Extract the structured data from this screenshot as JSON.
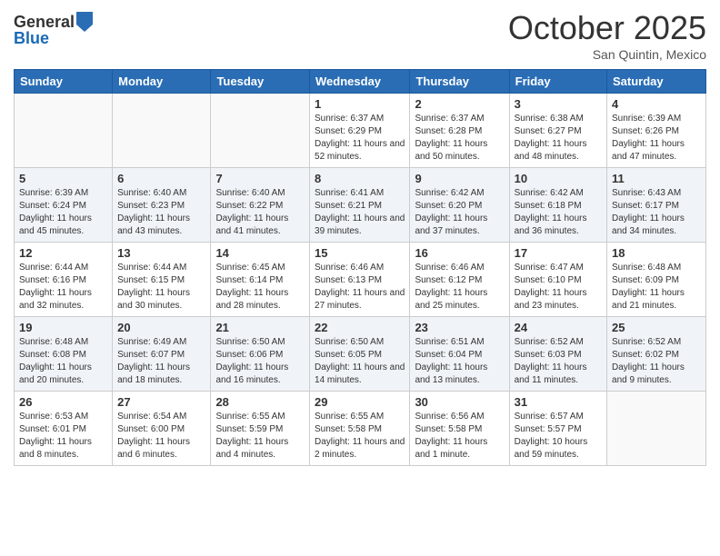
{
  "header": {
    "logo_general": "General",
    "logo_blue": "Blue",
    "month": "October 2025",
    "location": "San Quintin, Mexico"
  },
  "days_of_week": [
    "Sunday",
    "Monday",
    "Tuesday",
    "Wednesday",
    "Thursday",
    "Friday",
    "Saturday"
  ],
  "weeks": [
    [
      {
        "day": "",
        "info": ""
      },
      {
        "day": "",
        "info": ""
      },
      {
        "day": "",
        "info": ""
      },
      {
        "day": "1",
        "info": "Sunrise: 6:37 AM\nSunset: 6:29 PM\nDaylight: 11 hours and 52 minutes."
      },
      {
        "day": "2",
        "info": "Sunrise: 6:37 AM\nSunset: 6:28 PM\nDaylight: 11 hours and 50 minutes."
      },
      {
        "day": "3",
        "info": "Sunrise: 6:38 AM\nSunset: 6:27 PM\nDaylight: 11 hours and 48 minutes."
      },
      {
        "day": "4",
        "info": "Sunrise: 6:39 AM\nSunset: 6:26 PM\nDaylight: 11 hours and 47 minutes."
      }
    ],
    [
      {
        "day": "5",
        "info": "Sunrise: 6:39 AM\nSunset: 6:24 PM\nDaylight: 11 hours and 45 minutes."
      },
      {
        "day": "6",
        "info": "Sunrise: 6:40 AM\nSunset: 6:23 PM\nDaylight: 11 hours and 43 minutes."
      },
      {
        "day": "7",
        "info": "Sunrise: 6:40 AM\nSunset: 6:22 PM\nDaylight: 11 hours and 41 minutes."
      },
      {
        "day": "8",
        "info": "Sunrise: 6:41 AM\nSunset: 6:21 PM\nDaylight: 11 hours and 39 minutes."
      },
      {
        "day": "9",
        "info": "Sunrise: 6:42 AM\nSunset: 6:20 PM\nDaylight: 11 hours and 37 minutes."
      },
      {
        "day": "10",
        "info": "Sunrise: 6:42 AM\nSunset: 6:18 PM\nDaylight: 11 hours and 36 minutes."
      },
      {
        "day": "11",
        "info": "Sunrise: 6:43 AM\nSunset: 6:17 PM\nDaylight: 11 hours and 34 minutes."
      }
    ],
    [
      {
        "day": "12",
        "info": "Sunrise: 6:44 AM\nSunset: 6:16 PM\nDaylight: 11 hours and 32 minutes."
      },
      {
        "day": "13",
        "info": "Sunrise: 6:44 AM\nSunset: 6:15 PM\nDaylight: 11 hours and 30 minutes."
      },
      {
        "day": "14",
        "info": "Sunrise: 6:45 AM\nSunset: 6:14 PM\nDaylight: 11 hours and 28 minutes."
      },
      {
        "day": "15",
        "info": "Sunrise: 6:46 AM\nSunset: 6:13 PM\nDaylight: 11 hours and 27 minutes."
      },
      {
        "day": "16",
        "info": "Sunrise: 6:46 AM\nSunset: 6:12 PM\nDaylight: 11 hours and 25 minutes."
      },
      {
        "day": "17",
        "info": "Sunrise: 6:47 AM\nSunset: 6:10 PM\nDaylight: 11 hours and 23 minutes."
      },
      {
        "day": "18",
        "info": "Sunrise: 6:48 AM\nSunset: 6:09 PM\nDaylight: 11 hours and 21 minutes."
      }
    ],
    [
      {
        "day": "19",
        "info": "Sunrise: 6:48 AM\nSunset: 6:08 PM\nDaylight: 11 hours and 20 minutes."
      },
      {
        "day": "20",
        "info": "Sunrise: 6:49 AM\nSunset: 6:07 PM\nDaylight: 11 hours and 18 minutes."
      },
      {
        "day": "21",
        "info": "Sunrise: 6:50 AM\nSunset: 6:06 PM\nDaylight: 11 hours and 16 minutes."
      },
      {
        "day": "22",
        "info": "Sunrise: 6:50 AM\nSunset: 6:05 PM\nDaylight: 11 hours and 14 minutes."
      },
      {
        "day": "23",
        "info": "Sunrise: 6:51 AM\nSunset: 6:04 PM\nDaylight: 11 hours and 13 minutes."
      },
      {
        "day": "24",
        "info": "Sunrise: 6:52 AM\nSunset: 6:03 PM\nDaylight: 11 hours and 11 minutes."
      },
      {
        "day": "25",
        "info": "Sunrise: 6:52 AM\nSunset: 6:02 PM\nDaylight: 11 hours and 9 minutes."
      }
    ],
    [
      {
        "day": "26",
        "info": "Sunrise: 6:53 AM\nSunset: 6:01 PM\nDaylight: 11 hours and 8 minutes."
      },
      {
        "day": "27",
        "info": "Sunrise: 6:54 AM\nSunset: 6:00 PM\nDaylight: 11 hours and 6 minutes."
      },
      {
        "day": "28",
        "info": "Sunrise: 6:55 AM\nSunset: 5:59 PM\nDaylight: 11 hours and 4 minutes."
      },
      {
        "day": "29",
        "info": "Sunrise: 6:55 AM\nSunset: 5:58 PM\nDaylight: 11 hours and 2 minutes."
      },
      {
        "day": "30",
        "info": "Sunrise: 6:56 AM\nSunset: 5:58 PM\nDaylight: 11 hours and 1 minute."
      },
      {
        "day": "31",
        "info": "Sunrise: 6:57 AM\nSunset: 5:57 PM\nDaylight: 10 hours and 59 minutes."
      },
      {
        "day": "",
        "info": ""
      }
    ]
  ]
}
